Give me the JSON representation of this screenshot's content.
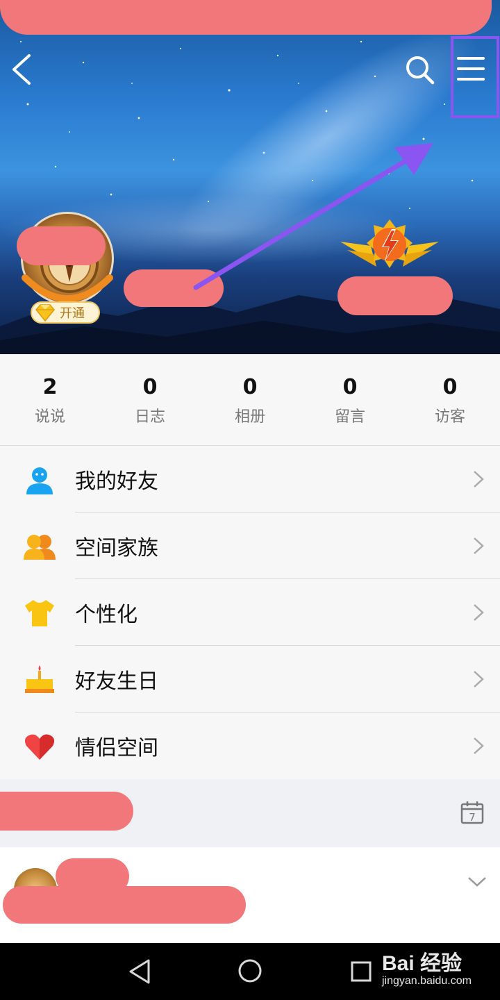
{
  "header": {
    "back_icon": "chevron-left-icon",
    "search_icon": "search-icon",
    "menu_icon": "hamburger-menu-icon"
  },
  "profile": {
    "vip_label": "开通"
  },
  "stats": [
    {
      "value": "2",
      "label": "说说"
    },
    {
      "value": "0",
      "label": "日志"
    },
    {
      "value": "0",
      "label": "相册"
    },
    {
      "value": "0",
      "label": "留言"
    },
    {
      "value": "0",
      "label": "访客"
    }
  ],
  "menu": [
    {
      "label": "我的好友",
      "icon": "friend-icon",
      "color": "#1aa3f0"
    },
    {
      "label": "空间家族",
      "icon": "family-icon",
      "color": "#f7b21c"
    },
    {
      "label": "个性化",
      "icon": "tshirt-icon",
      "color": "#f9c512"
    },
    {
      "label": "好友生日",
      "icon": "birthday-cake-icon",
      "color": "#f6a81a"
    },
    {
      "label": "情侣空间",
      "icon": "heart-icon",
      "color": "#f04343"
    }
  ],
  "section": {
    "calendar_day": "7"
  },
  "watermark": {
    "brand": "Bai 经验",
    "url": "jingyan.baidu.com"
  },
  "colors": {
    "highlight": "#8a55f0",
    "redaction": "#f2777a"
  }
}
